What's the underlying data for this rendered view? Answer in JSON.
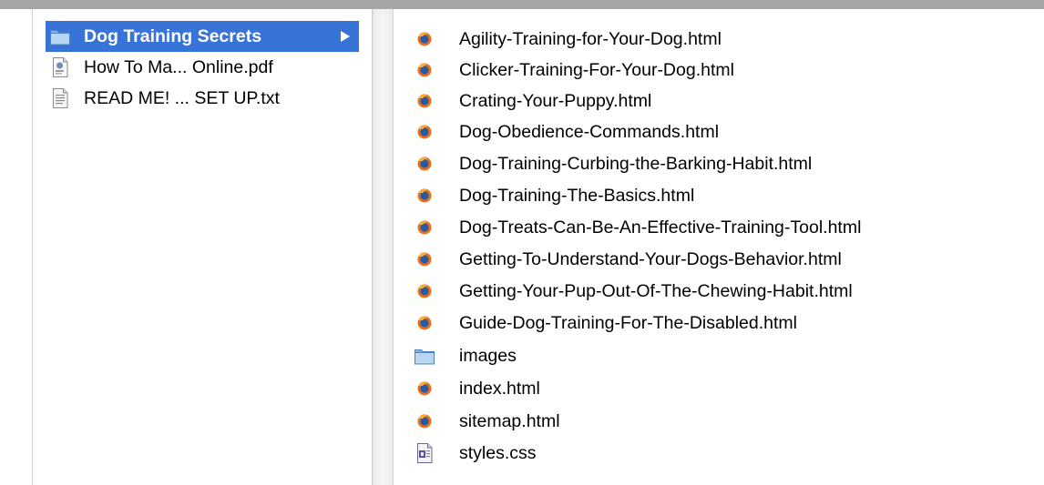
{
  "sidebar": {
    "items": [
      {
        "label": "Dog Training Secrets",
        "icon": "folder-icon",
        "selected": true
      },
      {
        "label": "How To Ma... Online.pdf",
        "icon": "pdf-file-icon",
        "selected": false
      },
      {
        "label": "READ ME! ... SET UP.txt",
        "icon": "text-file-icon",
        "selected": false
      }
    ]
  },
  "files": {
    "items": [
      {
        "label": "Agility-Training-for-Your-Dog.html",
        "icon": "html-file-icon"
      },
      {
        "label": "Clicker-Training-For-Your-Dog.html",
        "icon": "html-file-icon"
      },
      {
        "label": "Crating-Your-Puppy.html",
        "icon": "html-file-icon"
      },
      {
        "label": "Dog-Obedience-Commands.html",
        "icon": "html-file-icon"
      },
      {
        "label": "Dog-Training-Curbing-the-Barking-Habit.html",
        "icon": "html-file-icon"
      },
      {
        "label": "Dog-Training-The-Basics.html",
        "icon": "html-file-icon"
      },
      {
        "label": "Dog-Treats-Can-Be-An-Effective-Training-Tool.html",
        "icon": "html-file-icon"
      },
      {
        "label": "Getting-To-Understand-Your-Dogs-Behavior.html",
        "icon": "html-file-icon"
      },
      {
        "label": "Getting-Your-Pup-Out-Of-The-Chewing-Habit.html",
        "icon": "html-file-icon"
      },
      {
        "label": "Guide-Dog-Training-For-The-Disabled.html",
        "icon": "html-file-icon"
      },
      {
        "label": "images",
        "icon": "folder-icon"
      },
      {
        "label": "index.html",
        "icon": "html-file-icon"
      },
      {
        "label": "sitemap.html",
        "icon": "html-file-icon"
      },
      {
        "label": "styles.css",
        "icon": "css-file-icon"
      }
    ]
  },
  "colors": {
    "selection": "#3874d8",
    "folder": "#9cc4ea",
    "top_border": "#a6a6a6"
  }
}
